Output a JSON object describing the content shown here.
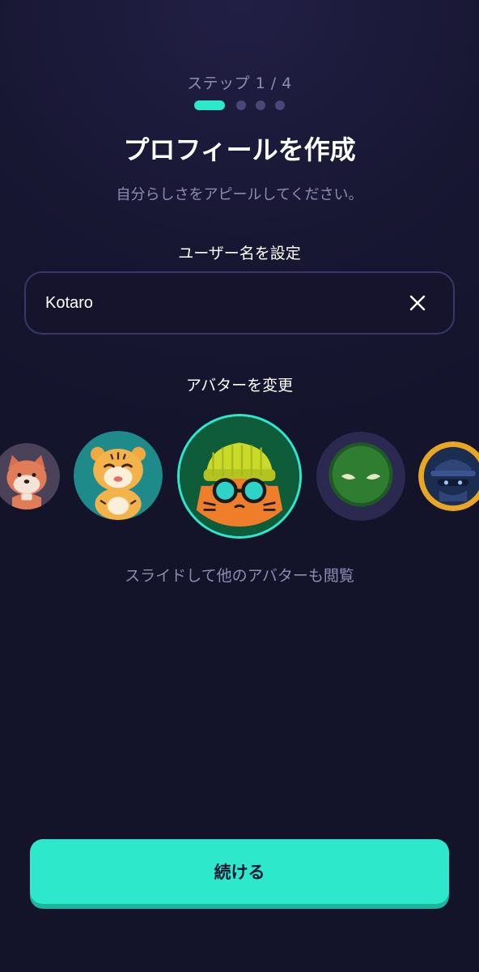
{
  "header": {
    "step_label": "ステップ 1 / 4",
    "steps_total": 4,
    "step_current": 1,
    "title": "プロフィールを作成",
    "subtitle": "自分らしさをアピールしてください。"
  },
  "username": {
    "label": "ユーザー名を設定",
    "value": "Kotaro",
    "clear_icon": "close-icon"
  },
  "avatar_picker": {
    "label": "アバターを変更",
    "avatars": [
      "shiba-dog",
      "tiger",
      "cat-with-beanie-and-glasses",
      "green-alien",
      "masked-robber"
    ],
    "selected": "cat-with-beanie-and-glasses",
    "hint": "スライドして他のアバターも閲覧"
  },
  "footer": {
    "continue_label": "続ける"
  },
  "colors": {
    "accent": "#2ee8cc",
    "background": "#16152e",
    "muted_text": "#8f8bb3",
    "input_border": "#3a3768"
  }
}
